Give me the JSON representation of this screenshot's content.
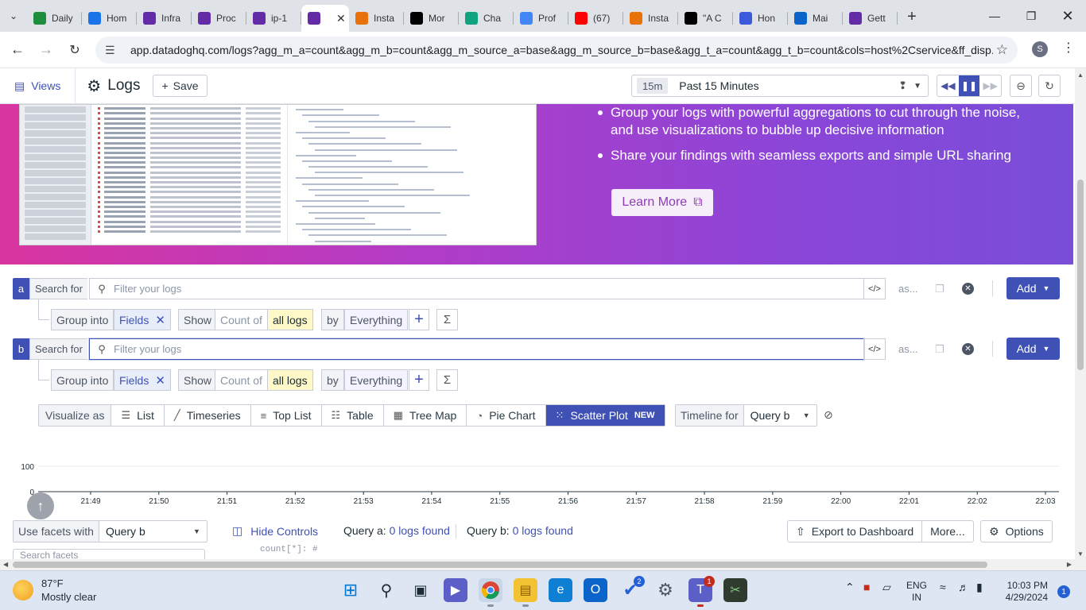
{
  "browser": {
    "tabs": [
      {
        "label": "Daily",
        "favicon": "sheets-icon",
        "color": "#1e8e3e"
      },
      {
        "label": "Hom",
        "favicon": "k-icon",
        "color": "#1a73e8"
      },
      {
        "label": "Infra",
        "favicon": "datadog-icon",
        "color": "#632ca6"
      },
      {
        "label": "Proc",
        "favicon": "datadog-icon",
        "color": "#632ca6"
      },
      {
        "label": "ip-1",
        "favicon": "datadog-icon",
        "color": "#632ca6"
      },
      {
        "label": "",
        "favicon": "datadog-icon",
        "color": "#632ca6",
        "active": true
      },
      {
        "label": "Insta",
        "favicon": "aws-icon",
        "color": "#e8710a"
      },
      {
        "label": "Mor",
        "favicon": "medium-icon",
        "color": "#000000"
      },
      {
        "label": "Cha",
        "favicon": "chatgpt-icon",
        "color": "#10a37f"
      },
      {
        "label": "Prof",
        "favicon": "gcloud-icon",
        "color": "#4285f4"
      },
      {
        "label": "(67)",
        "favicon": "youtube-icon",
        "color": "#ff0000"
      },
      {
        "label": "Insta",
        "favicon": "aws-icon",
        "color": "#e8710a"
      },
      {
        "label": "\"A C",
        "favicon": "medium-icon",
        "color": "#000000"
      },
      {
        "label": "Hon",
        "favicon": "copilot-icon",
        "color": "#3b5bdb"
      },
      {
        "label": "Mai",
        "favicon": "outlook-icon",
        "color": "#0a64c9"
      },
      {
        "label": "Gett",
        "favicon": "datadog-icon",
        "color": "#632ca6"
      }
    ],
    "url": "app.datadoghq.com/logs?agg_m_a=count&agg_m_b=count&agg_m_source_a=base&agg_m_source_b=base&agg_t_a=count&agg_t_b=count&cols=host%2Cservice&ff_disp...",
    "profile_initial": "S"
  },
  "header": {
    "views_label": "Views",
    "title": "Logs",
    "save_label": "Save",
    "time_badge": "15m",
    "time_label": "Past 15 Minutes"
  },
  "banner": {
    "bullets": [
      "Group your logs with powerful aggregations to cut through the noise, and use visualizations to bubble up decisive information",
      "Share your findings with seamless exports and simple URL sharing"
    ],
    "learn_more": "Learn More"
  },
  "queries": [
    {
      "letter": "a",
      "search_for": "Search for",
      "placeholder": "Filter your logs",
      "as": "as...",
      "add": "Add",
      "group_into": "Group into",
      "fields": "Fields",
      "show": "Show",
      "count_of": "Count of",
      "all_logs": "all logs",
      "by": "by",
      "everything": "Everything"
    },
    {
      "letter": "b",
      "search_for": "Search for",
      "placeholder": "Filter your logs",
      "as": "as...",
      "add": "Add",
      "group_into": "Group into",
      "fields": "Fields",
      "show": "Show",
      "count_of": "Count of",
      "all_logs": "all logs",
      "by": "by",
      "everything": "Everything"
    }
  ],
  "visualize": {
    "label": "Visualize as",
    "options": [
      {
        "label": "List",
        "icon": "list-icon"
      },
      {
        "label": "Timeseries",
        "icon": "timeseries-icon"
      },
      {
        "label": "Top List",
        "icon": "toplist-icon"
      },
      {
        "label": "Table",
        "icon": "table-icon"
      },
      {
        "label": "Tree Map",
        "icon": "treemap-icon"
      },
      {
        "label": "Pie Chart",
        "icon": "piechart-icon"
      },
      {
        "label": "Scatter Plot",
        "icon": "scatter-icon",
        "active": true,
        "badge": "NEW"
      }
    ],
    "timeline_label": "Timeline for",
    "timeline_value": "Query b"
  },
  "chart_data": {
    "type": "scatter",
    "title": "",
    "xlabel": "",
    "ylabel": "",
    "x_ticks": [
      "21:49",
      "21:50",
      "21:51",
      "21:52",
      "21:53",
      "21:54",
      "21:55",
      "21:56",
      "21:57",
      "21:58",
      "21:59",
      "22:00",
      "22:01",
      "22:02",
      "22:03"
    ],
    "y_ticks": [
      "0",
      "100"
    ],
    "ylim": [
      0,
      100
    ],
    "series": [],
    "grid": true
  },
  "bottom": {
    "facets_label": "Use facets with",
    "facets_value": "Query b",
    "hide_controls": "Hide Controls",
    "query_a_label": "Query a:",
    "query_a_result": "0 logs found",
    "query_b_label": "Query b:",
    "query_b_result": "0 logs found",
    "export": "Export to Dashboard",
    "more": "More...",
    "options": "Options",
    "facet_search_placeholder": "Search facets",
    "count_line": "count[*]: #"
  },
  "taskbar": {
    "temperature": "87°F",
    "condition": "Mostly clear",
    "lang_line1": "ENG",
    "lang_line2": "IN",
    "time": "10:03 PM",
    "date": "4/29/2024",
    "outlook_badge": "",
    "todo_badge": "2",
    "teams_badge": "1",
    "notif_count": "1"
  }
}
